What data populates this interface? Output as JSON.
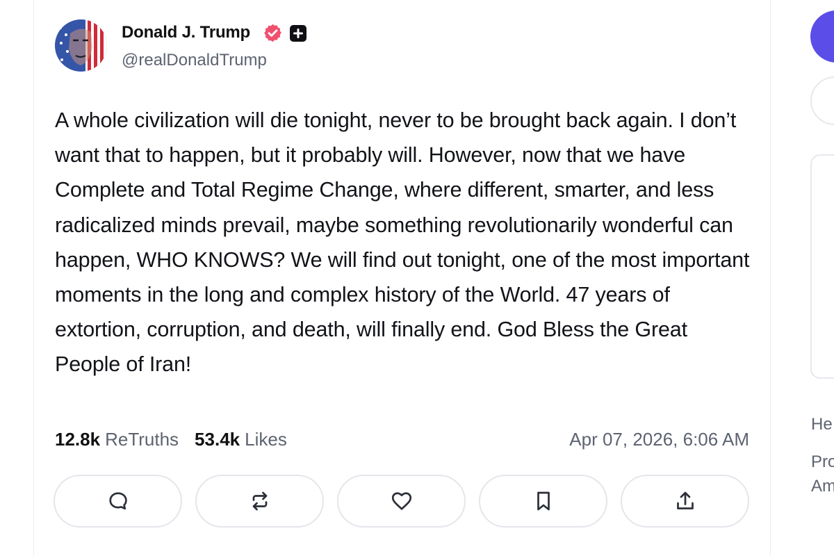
{
  "post": {
    "author_name": "Donald J. Trump",
    "handle": "@realDonaldTrump",
    "body": "A whole civilization will die tonight, never to be brought back again. I don’t want that to happen, but it probably will. However, now that we have Complete and Total Regime Change, where different, smarter, and less radicalized minds prevail, maybe something revolutionarily wonderful can happen, WHO KNOWS? We will find out tonight, one of the most important moments in the long and complex history of the World. 47 years of extortion, corruption, and death, will finally end. God Bless the Great People of Iran!",
    "retruths_count": "12.8k",
    "retruths_label": "ReTruths",
    "likes_count": "53.4k",
    "likes_label": "Likes",
    "timestamp": "Apr 07, 2026, 6:06 AM"
  },
  "actions": [
    {
      "name": "reply",
      "icon": "speech-bubble-icon"
    },
    {
      "name": "retruth",
      "icon": "repost-arrows-icon"
    },
    {
      "name": "like",
      "icon": "heart-icon"
    },
    {
      "name": "bookmark",
      "icon": "bookmark-icon"
    },
    {
      "name": "share",
      "icon": "share-upload-icon"
    }
  ],
  "sidebar": {
    "link_1": "He",
    "link_2_line_1": "Pro",
    "link_2_line_2": "Am"
  },
  "colors": {
    "accent": "#5b4ee8",
    "verified": "#f0506e",
    "text_primary": "#111318",
    "text_secondary": "#5d6370",
    "border": "#e4e6eb"
  }
}
